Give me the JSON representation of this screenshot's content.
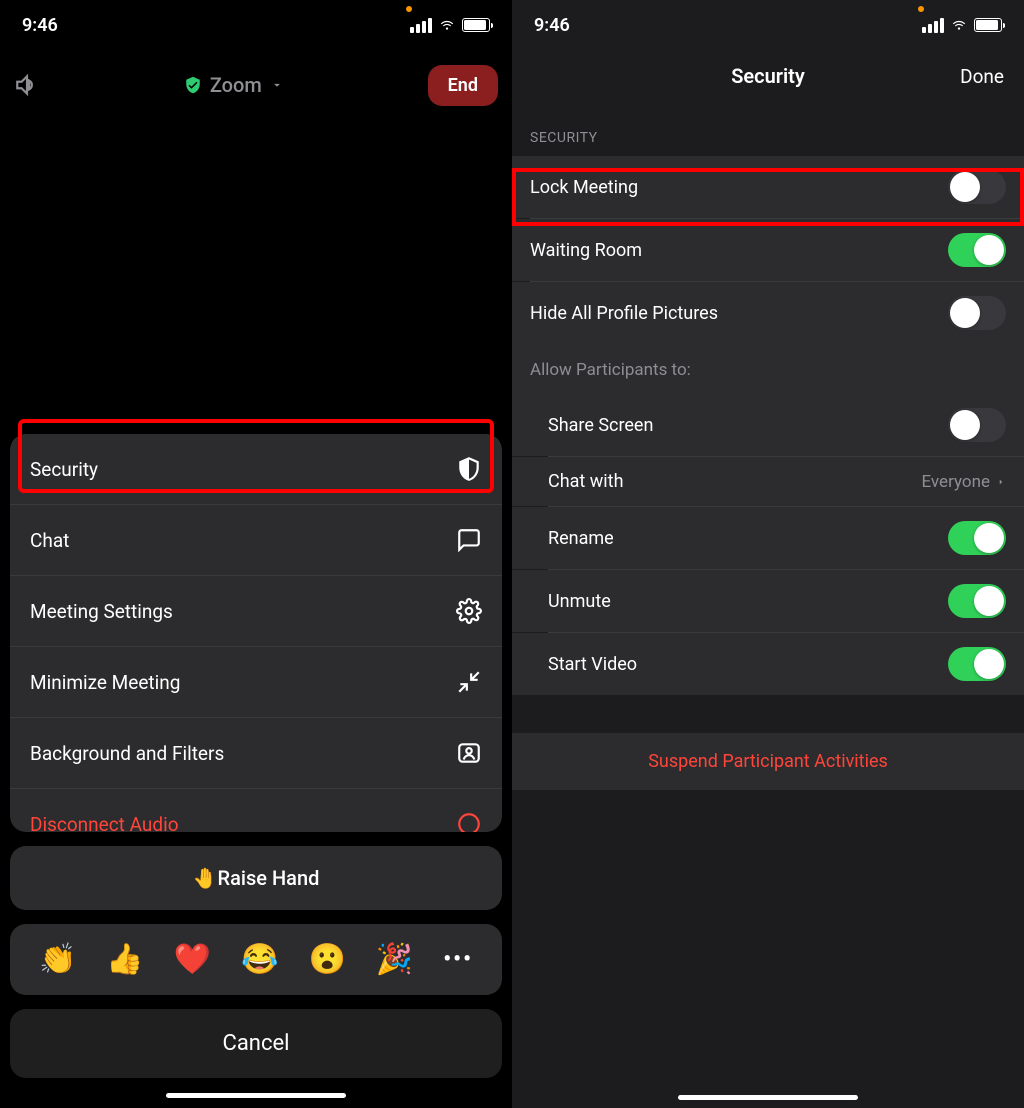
{
  "status": {
    "time": "9:46"
  },
  "left": {
    "header": {
      "title": "Zoom",
      "end": "End"
    },
    "menu": {
      "security": "Security",
      "chat": "Chat",
      "meeting_settings": "Meeting Settings",
      "minimize": "Minimize Meeting",
      "background": "Background and Filters",
      "disconnect": "Disconnect Audio"
    },
    "raise_hand": "Raise Hand",
    "reactions": {
      "clap": "👏",
      "thumbs": "👍",
      "heart": "❤️",
      "joy": "😂",
      "wow": "😮",
      "tada": "🎉",
      "more": "•••"
    },
    "cancel": "Cancel"
  },
  "right": {
    "title": "Security",
    "done": "Done",
    "section": "SECURITY",
    "lock_meeting": "Lock Meeting",
    "waiting_room": "Waiting Room",
    "hide_profile": "Hide All Profile Pictures",
    "allow_header": "Allow Participants to:",
    "share_screen": "Share Screen",
    "chat_with": "Chat with",
    "chat_with_value": "Everyone",
    "rename": "Rename",
    "unmute": "Unmute",
    "start_video": "Start Video",
    "suspend": "Suspend Participant Activities",
    "toggles": {
      "lock_meeting": false,
      "waiting_room": true,
      "hide_profile": false,
      "share_screen": false,
      "rename": true,
      "unmute": true,
      "start_video": true
    }
  }
}
